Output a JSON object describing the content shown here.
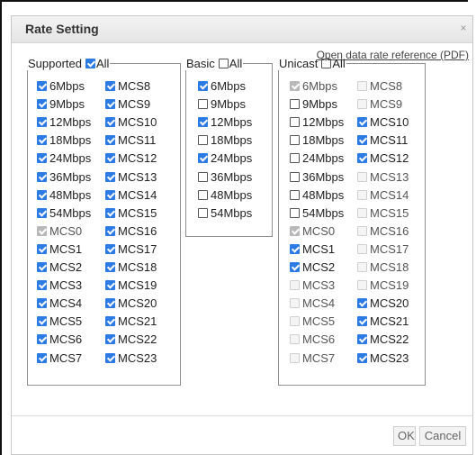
{
  "dialog": {
    "title": "Rate Setting",
    "close_label": "×",
    "ok_label": "OK",
    "cancel_label": "Cancel"
  },
  "ref_link": "Open data rate reference (PDF)",
  "supported": {
    "legend": "Supported",
    "all_label": "All",
    "all_checked": true,
    "col1": [
      {
        "label": "6Mbps",
        "checked": true,
        "disabled": false
      },
      {
        "label": "9Mbps",
        "checked": true,
        "disabled": false
      },
      {
        "label": "12Mbps",
        "checked": true,
        "disabled": false
      },
      {
        "label": "18Mbps",
        "checked": true,
        "disabled": false
      },
      {
        "label": "24Mbps",
        "checked": true,
        "disabled": false
      },
      {
        "label": "36Mbps",
        "checked": true,
        "disabled": false
      },
      {
        "label": "48Mbps",
        "checked": true,
        "disabled": false
      },
      {
        "label": "54Mbps",
        "checked": true,
        "disabled": false
      },
      {
        "label": "MCS0",
        "checked": true,
        "disabled": true
      },
      {
        "label": "MCS1",
        "checked": true,
        "disabled": false
      },
      {
        "label": "MCS2",
        "checked": true,
        "disabled": false
      },
      {
        "label": "MCS3",
        "checked": true,
        "disabled": false
      },
      {
        "label": "MCS4",
        "checked": true,
        "disabled": false
      },
      {
        "label": "MCS5",
        "checked": true,
        "disabled": false
      },
      {
        "label": "MCS6",
        "checked": true,
        "disabled": false
      },
      {
        "label": "MCS7",
        "checked": true,
        "disabled": false
      }
    ],
    "col2": [
      {
        "label": "MCS8",
        "checked": true,
        "disabled": false
      },
      {
        "label": "MCS9",
        "checked": true,
        "disabled": false
      },
      {
        "label": "MCS10",
        "checked": true,
        "disabled": false
      },
      {
        "label": "MCS11",
        "checked": true,
        "disabled": false
      },
      {
        "label": "MCS12",
        "checked": true,
        "disabled": false
      },
      {
        "label": "MCS13",
        "checked": true,
        "disabled": false
      },
      {
        "label": "MCS14",
        "checked": true,
        "disabled": false
      },
      {
        "label": "MCS15",
        "checked": true,
        "disabled": false
      },
      {
        "label": "MCS16",
        "checked": true,
        "disabled": false
      },
      {
        "label": "MCS17",
        "checked": true,
        "disabled": false
      },
      {
        "label": "MCS18",
        "checked": true,
        "disabled": false
      },
      {
        "label": "MCS19",
        "checked": true,
        "disabled": false
      },
      {
        "label": "MCS20",
        "checked": true,
        "disabled": false
      },
      {
        "label": "MCS21",
        "checked": true,
        "disabled": false
      },
      {
        "label": "MCS22",
        "checked": true,
        "disabled": false
      },
      {
        "label": "MCS23",
        "checked": true,
        "disabled": false
      }
    ]
  },
  "basic": {
    "legend": "Basic",
    "all_label": "All",
    "all_checked": false,
    "col1": [
      {
        "label": "6Mbps",
        "checked": true,
        "disabled": false
      },
      {
        "label": "9Mbps",
        "checked": false,
        "disabled": false
      },
      {
        "label": "12Mbps",
        "checked": true,
        "disabled": false
      },
      {
        "label": "18Mbps",
        "checked": false,
        "disabled": false
      },
      {
        "label": "24Mbps",
        "checked": true,
        "disabled": false
      },
      {
        "label": "36Mbps",
        "checked": false,
        "disabled": false
      },
      {
        "label": "48Mbps",
        "checked": false,
        "disabled": false
      },
      {
        "label": "54Mbps",
        "checked": false,
        "disabled": false
      }
    ]
  },
  "unicast": {
    "legend": "Unicast",
    "all_label": "All",
    "all_checked": false,
    "col1": [
      {
        "label": "6Mbps",
        "checked": true,
        "disabled": true
      },
      {
        "label": "9Mbps",
        "checked": false,
        "disabled": false
      },
      {
        "label": "12Mbps",
        "checked": false,
        "disabled": false
      },
      {
        "label": "18Mbps",
        "checked": false,
        "disabled": false
      },
      {
        "label": "24Mbps",
        "checked": false,
        "disabled": false
      },
      {
        "label": "36Mbps",
        "checked": false,
        "disabled": false
      },
      {
        "label": "48Mbps",
        "checked": false,
        "disabled": false
      },
      {
        "label": "54Mbps",
        "checked": false,
        "disabled": false
      },
      {
        "label": "MCS0",
        "checked": true,
        "disabled": true
      },
      {
        "label": "MCS1",
        "checked": true,
        "disabled": false
      },
      {
        "label": "MCS2",
        "checked": true,
        "disabled": false
      },
      {
        "label": "MCS3",
        "checked": false,
        "disabled": true
      },
      {
        "label": "MCS4",
        "checked": false,
        "disabled": true
      },
      {
        "label": "MCS5",
        "checked": false,
        "disabled": true
      },
      {
        "label": "MCS6",
        "checked": false,
        "disabled": true
      },
      {
        "label": "MCS7",
        "checked": false,
        "disabled": true
      }
    ],
    "col2": [
      {
        "label": "MCS8",
        "checked": false,
        "disabled": true
      },
      {
        "label": "MCS9",
        "checked": false,
        "disabled": true
      },
      {
        "label": "MCS10",
        "checked": true,
        "disabled": false
      },
      {
        "label": "MCS11",
        "checked": true,
        "disabled": false
      },
      {
        "label": "MCS12",
        "checked": true,
        "disabled": false
      },
      {
        "label": "MCS13",
        "checked": false,
        "disabled": true
      },
      {
        "label": "MCS14",
        "checked": false,
        "disabled": true
      },
      {
        "label": "MCS15",
        "checked": false,
        "disabled": true
      },
      {
        "label": "MCS16",
        "checked": false,
        "disabled": true
      },
      {
        "label": "MCS17",
        "checked": false,
        "disabled": true
      },
      {
        "label": "MCS18",
        "checked": false,
        "disabled": true
      },
      {
        "label": "MCS19",
        "checked": false,
        "disabled": true
      },
      {
        "label": "MCS20",
        "checked": true,
        "disabled": false
      },
      {
        "label": "MCS21",
        "checked": true,
        "disabled": false
      },
      {
        "label": "MCS22",
        "checked": true,
        "disabled": false
      },
      {
        "label": "MCS23",
        "checked": true,
        "disabled": false
      }
    ]
  }
}
